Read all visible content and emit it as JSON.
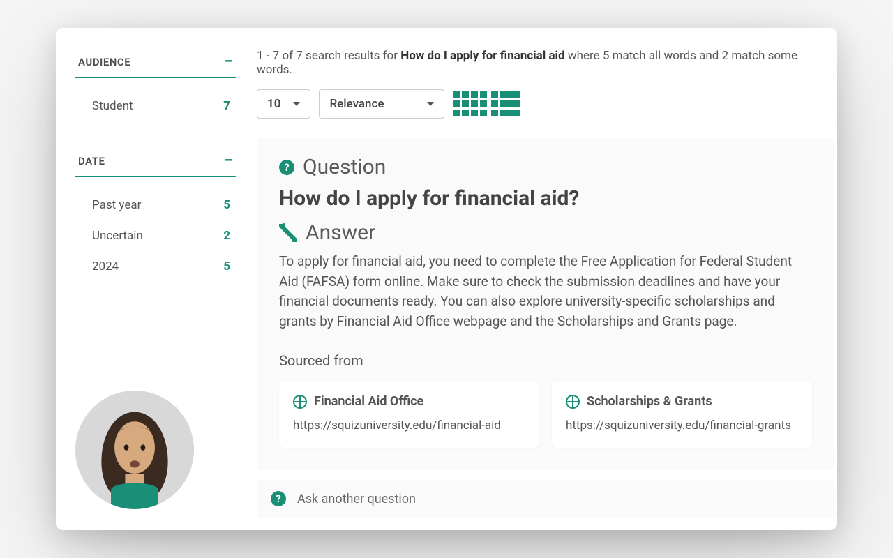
{
  "summary": {
    "prefix": "1 - 7 of 7 search results for ",
    "query": "How do I apply for financial aid",
    "suffix": " where 5 match all words and 2 match some words."
  },
  "controls": {
    "page_size": "10",
    "sort": "Relevance"
  },
  "facets": {
    "audience": {
      "title": "AUDIENCE",
      "items": [
        {
          "label": "Student",
          "count": "7"
        }
      ]
    },
    "date": {
      "title": "DATE",
      "items": [
        {
          "label": "Past year",
          "count": "5"
        },
        {
          "label": "Uncertain",
          "count": "2"
        },
        {
          "label": "2024",
          "count": "5"
        }
      ]
    }
  },
  "qa": {
    "question_label": "Question",
    "question_text": "How do I apply for financial aid?",
    "answer_label": "Answer",
    "answer_text": "To apply for financial aid, you need to complete the Free Application for Federal Student Aid (FAFSA) form online. Make sure to check the submission deadlines and have your financial documents ready. You can also explore university-specific scholarships and grants by Financial Aid Office webpage and the Scholarships and Grants page.",
    "sourced_label": "Sourced from",
    "sources": [
      {
        "title": "Financial Aid Office",
        "url": "https://squizuniversity.edu/financial-aid"
      },
      {
        "title": "Scholarships & Grants",
        "url": "https://squizuniversity.edu/financial-grants"
      }
    ]
  },
  "ask_another": "Ask another question"
}
